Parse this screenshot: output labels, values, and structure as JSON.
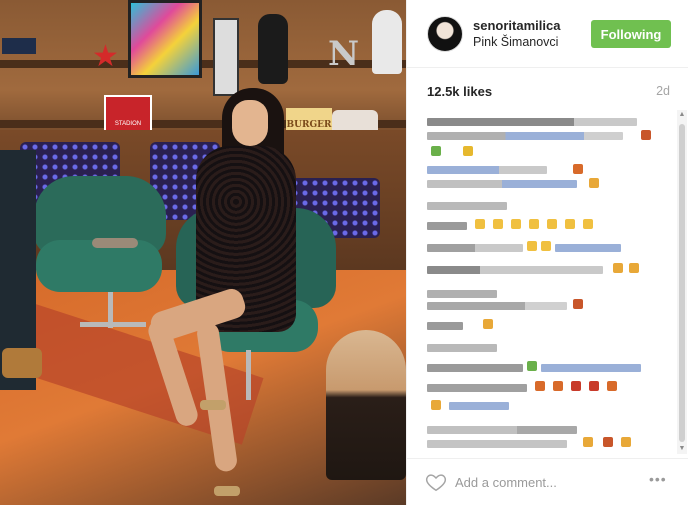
{
  "post": {
    "username": "senoritamilica",
    "location": "Pink Šimanovci",
    "follow_label": "Following",
    "likes": "12.5k likes",
    "age": "2d"
  },
  "scene_signs": {
    "plaque": "STADION",
    "burger": "BURGER"
  },
  "comment_box": {
    "placeholder": "Add a comment...",
    "more_label": "•••"
  },
  "colors": {
    "follow_button": "#70c050",
    "text": "#262626",
    "muted": "#a5a5a5",
    "comment_text_blur": "#8a8a8a",
    "comment_link_blur": "#9ab0d8"
  },
  "icons": [
    "heart-icon",
    "more-options-icon",
    "scroll-up-icon",
    "scroll-down-icon"
  ]
}
